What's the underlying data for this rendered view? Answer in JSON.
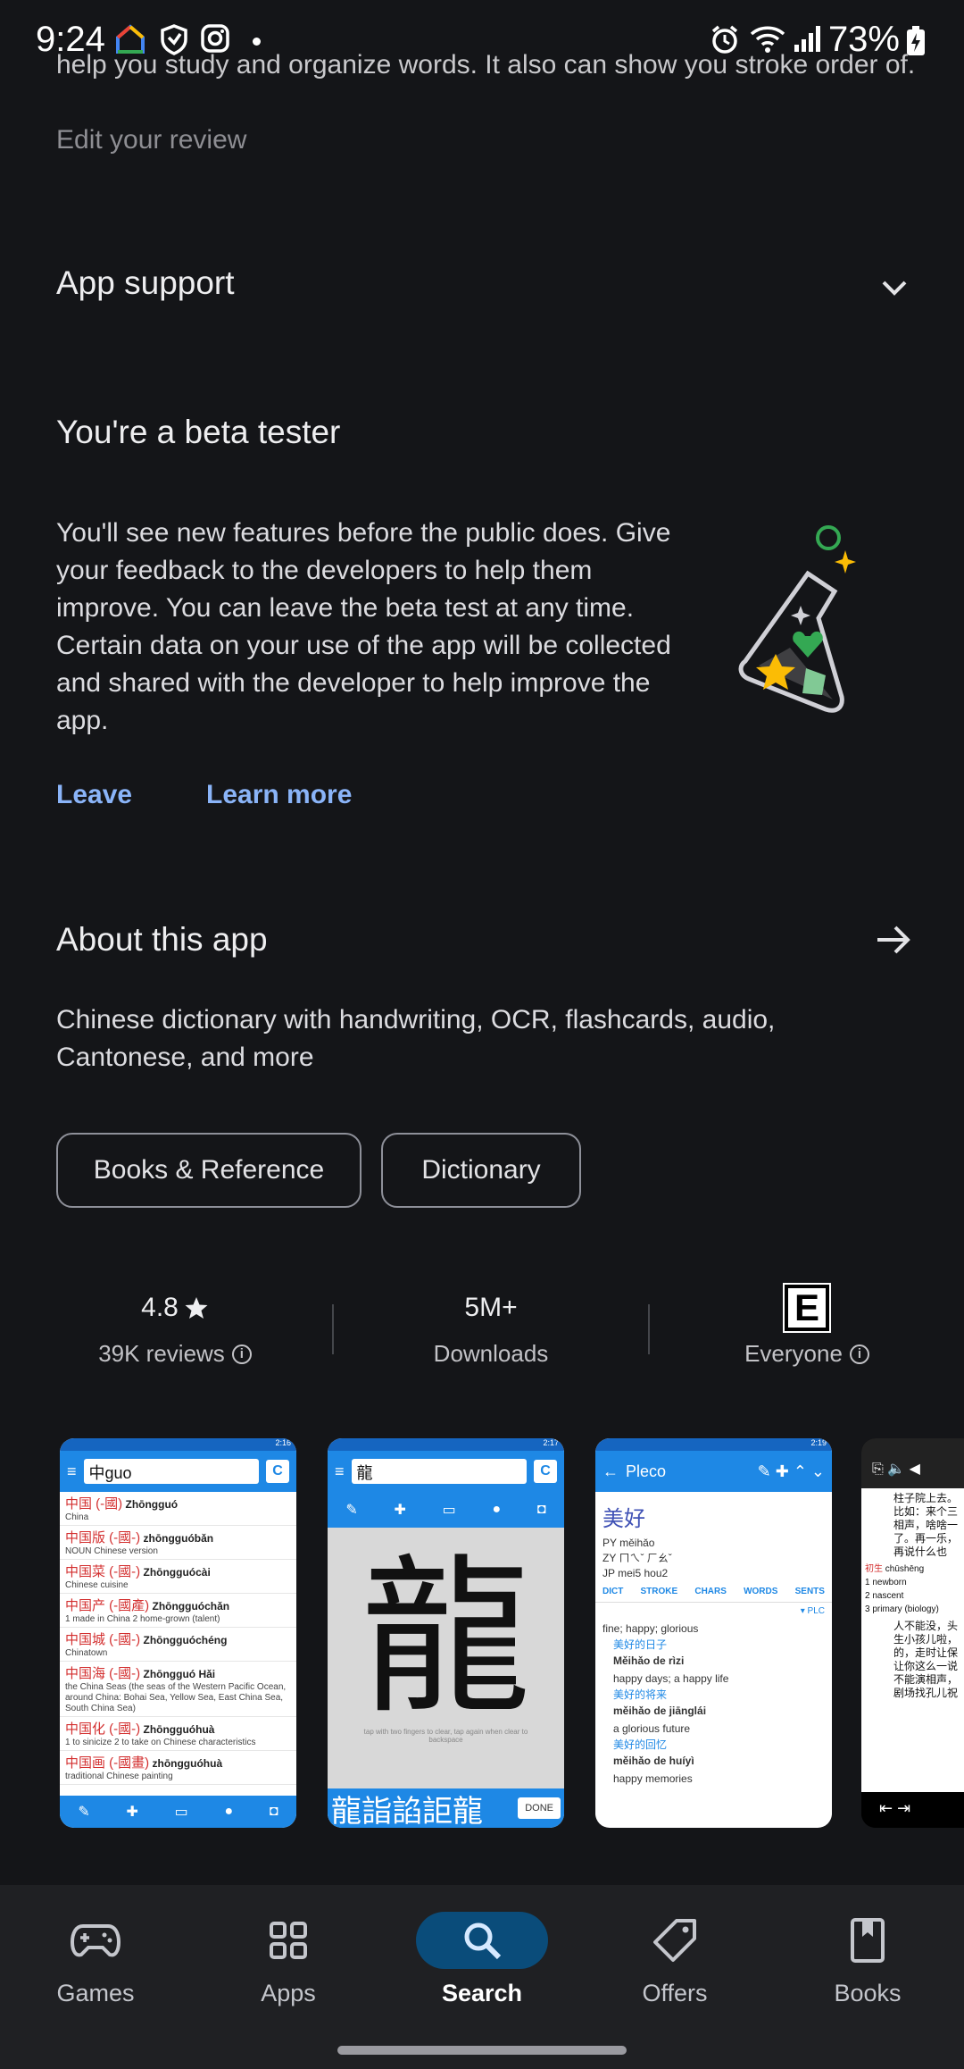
{
  "status_bar": {
    "time": "9:24",
    "battery": "73%"
  },
  "review": {
    "partial_text": "help you study and organize words. It also can show you stroke order of...",
    "edit_label": "Edit your review"
  },
  "app_support": {
    "title": "App support"
  },
  "beta": {
    "title": "You're a beta tester",
    "description": "You'll see new features before the public does. Give your feedback to the developers to help them improve. You can leave the beta test at any time. Certain data on your use of the app will be collected and shared with the developer to help improve the app.",
    "leave_label": "Leave",
    "learn_more_label": "Learn more"
  },
  "about": {
    "title": "About this app",
    "description": "Chinese dictionary with handwriting, OCR, flashcards, audio, Cantonese, and more",
    "chips": [
      "Books & Reference",
      "Dictionary"
    ]
  },
  "stats": {
    "rating": "4.8",
    "reviews": "39K reviews",
    "downloads_value": "5M+",
    "downloads_label": "Downloads",
    "content_rating_badge": "E",
    "content_rating": "Everyone"
  },
  "screenshots": {
    "shot1": {
      "time": "2:16",
      "query": "中guo",
      "c_button": "C",
      "entries": [
        {
          "hz": "中国 (-國)",
          "py": "Zhōngguó",
          "def": "China"
        },
        {
          "hz": "中国版 (-國-)",
          "py": "zhōngguóbǎn",
          "def": "NOUN Chinese version"
        },
        {
          "hz": "中国菜 (-國-)",
          "py": "Zhōngguócài",
          "def": "Chinese cuisine"
        },
        {
          "hz": "中国产 (-國產)",
          "py": "Zhōngguóchǎn",
          "def": "1 made in China 2 home-grown (talent)"
        },
        {
          "hz": "中国城 (-國-)",
          "py": "Zhōngguóchéng",
          "def": "Chinatown"
        },
        {
          "hz": "中国海 (-國-)",
          "py": "Zhōngguó Hǎi",
          "def": "the China Seas (the seas of the Western Pacific Ocean, around China: Bohai Sea, Yellow Sea, East China Sea, South China Sea)"
        },
        {
          "hz": "中国化 (-國-)",
          "py": "Zhōngguóhuà",
          "def": "1 to sinicize 2 to take on Chinese characteristics"
        },
        {
          "hz": "中国画 (-國畫)",
          "py": "zhōngguóhuà",
          "def": "traditional Chinese painting"
        }
      ]
    },
    "shot2": {
      "time": "2:17",
      "query": "龍",
      "c_button": "C",
      "drawn_char": "龍",
      "hint": "tap with two fingers to clear, tap again when clear to backspace",
      "candidates": "龍詣諂詎龍",
      "done_label": "DONE"
    },
    "shot3": {
      "time": "2:19",
      "title": "Pleco",
      "word": "美好",
      "py": "PY měihǎo",
      "zy": "ZY ㄇㄟˇ ㄏㄠˇ",
      "jp": "JP mei5 hou2",
      "tabs": [
        "DICT",
        "STROKE",
        "CHARS",
        "WORDS",
        "SENTS"
      ],
      "source": "▾ PLC",
      "definition": "fine; happy; glorious",
      "examples": [
        {
          "hz": "美好的日子",
          "py": "Měihǎo de rìzi",
          "en": "happy days; a happy life"
        },
        {
          "hz": "美好的将来",
          "py": "měihǎo de jiānglái",
          "en": "a glorious future"
        },
        {
          "hz": "美好的回忆",
          "py": "měihǎo de huíyì",
          "en": "happy memories"
        }
      ]
    },
    "shot4": {
      "lines": [
        "柱子院上去。",
        "比如：来个三",
        "相声，啥啥一",
        "了。再一乐，",
        "再说什么也"
      ],
      "entry_hz": "初生",
      "entry_py": "chūshēng",
      "senses": [
        "1 newborn",
        "2 nascent",
        "3 primary (biology)"
      ],
      "lines2": [
        "人不能没，头",
        "生小孩儿啦，",
        "的，走时让保",
        "让你这么一说",
        "不能演相声，",
        "剧场找孔儿祝"
      ]
    }
  },
  "nav": {
    "items": [
      {
        "label": "Games",
        "icon": "gamepad-icon"
      },
      {
        "label": "Apps",
        "icon": "apps-grid-icon"
      },
      {
        "label": "Search",
        "icon": "search-icon"
      },
      {
        "label": "Offers",
        "icon": "tag-icon"
      },
      {
        "label": "Books",
        "icon": "bookmark-book-icon"
      }
    ],
    "active": "Search"
  },
  "colors": {
    "background": "#141518",
    "link": "#8ab4f8",
    "nav_active_pill": "#0a4c7a"
  }
}
